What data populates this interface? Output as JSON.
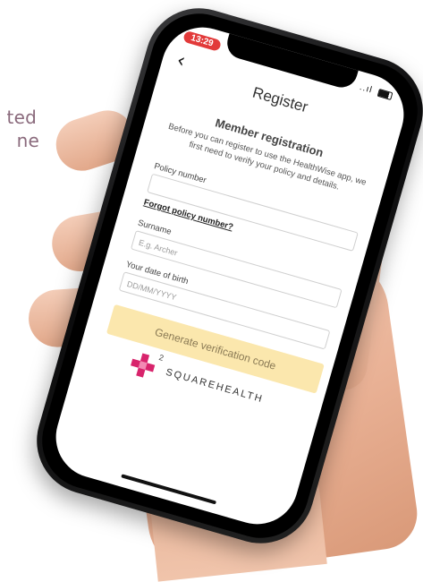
{
  "background": {
    "line1": "ted",
    "line2": "ne"
  },
  "status": {
    "time": "13:29",
    "signal": "..ıl"
  },
  "header": {
    "back_icon": "chevron-left-icon",
    "back_glyph": "‹",
    "title": "Register"
  },
  "form": {
    "subtitle": "Member registration",
    "description": "Before you can register to use the HealthWise app, we first need to verify your policy and details.",
    "policy_label": "Policy number",
    "policy_value": "",
    "forgot_link": "Forgot policy number?",
    "surname_label": "Surname",
    "surname_placeholder": "E.g. Archer",
    "dob_label": "Your date of birth",
    "dob_placeholder": "DD/MM/YYYY",
    "submit_label": "Generate verification code"
  },
  "logo": {
    "sup": "2",
    "text": "SQUAREHEALTH"
  },
  "colors": {
    "button_bg": "#fbe7ad",
    "logo_pink": "#d8246c",
    "time_pill": "#e23a3a"
  }
}
